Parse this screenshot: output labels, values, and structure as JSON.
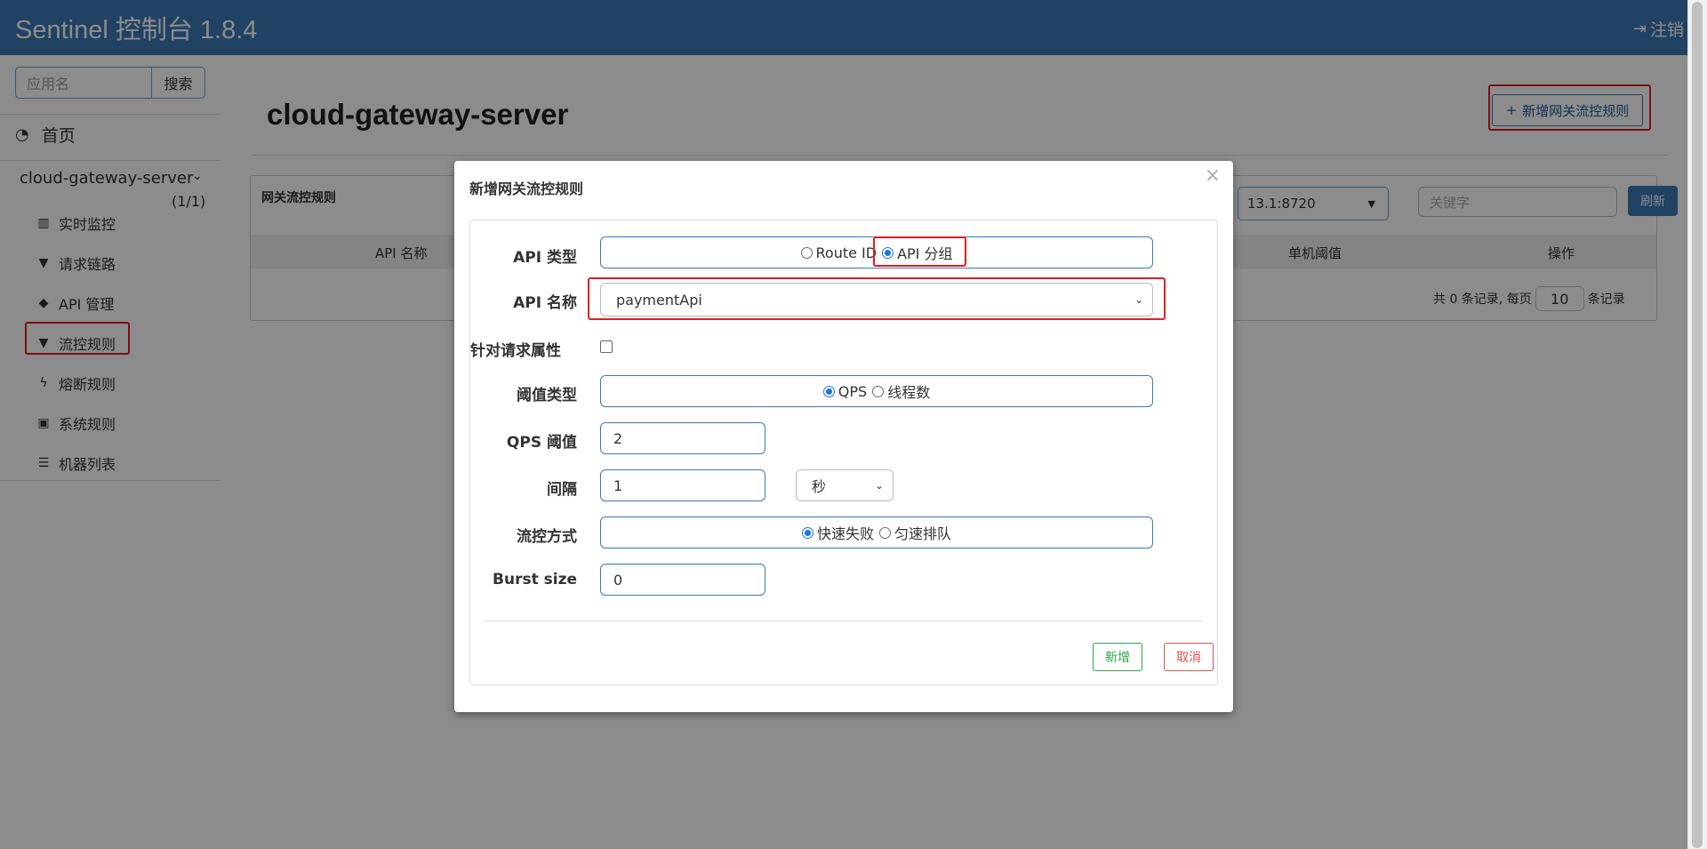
{
  "header": {
    "brand": "Sentinel 控制台 1.8.4",
    "logout": "注销"
  },
  "sidebar": {
    "search_placeholder": "应用名",
    "search_button": "搜索",
    "home": "首页",
    "app": {
      "name": "cloud-gateway-server",
      "count": "(1/1)"
    },
    "items": [
      {
        "label": "实时监控",
        "icon": "bar-chart-icon"
      },
      {
        "label": "请求链路",
        "icon": "filter-icon"
      },
      {
        "label": "API 管理",
        "icon": "tags-icon"
      },
      {
        "label": "流控规则",
        "icon": "filter-icon",
        "highlighted": true
      },
      {
        "label": "熔断规则",
        "icon": "bolt-icon"
      },
      {
        "label": "系统规则",
        "icon": "lock-icon"
      },
      {
        "label": "机器列表",
        "icon": "list-icon"
      }
    ]
  },
  "main": {
    "title": "cloud-gateway-server",
    "add_button": "新增网关流控规则",
    "panel": {
      "heading": "网关流控规则",
      "machine": "13.1:8720",
      "keyword_placeholder": "关键字",
      "refresh": "刷新",
      "columns": [
        "API 名称",
        "单机阈值",
        "操作"
      ],
      "pager_prefix": "共 0 条记录, 每页",
      "page_size": "10",
      "pager_suffix": "条记录"
    }
  },
  "modal": {
    "title": "新增网关流控规则",
    "close": "×",
    "api_type": {
      "label": "API 类型",
      "options": [
        "Route ID",
        "API 分组"
      ],
      "selected": "API 分组"
    },
    "api_name": {
      "label": "API 名称",
      "value": "paymentApi"
    },
    "request_attr": {
      "label": "针对请求属性",
      "checked": false
    },
    "threshold_type": {
      "label": "阈值类型",
      "options": [
        "QPS",
        "线程数"
      ],
      "selected": "QPS"
    },
    "qps": {
      "label": "QPS 阈值",
      "value": "2"
    },
    "interval": {
      "label": "间隔",
      "value": "1",
      "unit": "秒"
    },
    "control_mode": {
      "label": "流控方式",
      "options": [
        "快速失败",
        "匀速排队"
      ],
      "selected": "快速失败"
    },
    "burst": {
      "label": "Burst size",
      "value": "0"
    },
    "ok": "新增",
    "cancel": "取消"
  },
  "colors": {
    "header": "#3c78b5",
    "highlight": "#e02020",
    "primary": "#3c78b5"
  }
}
